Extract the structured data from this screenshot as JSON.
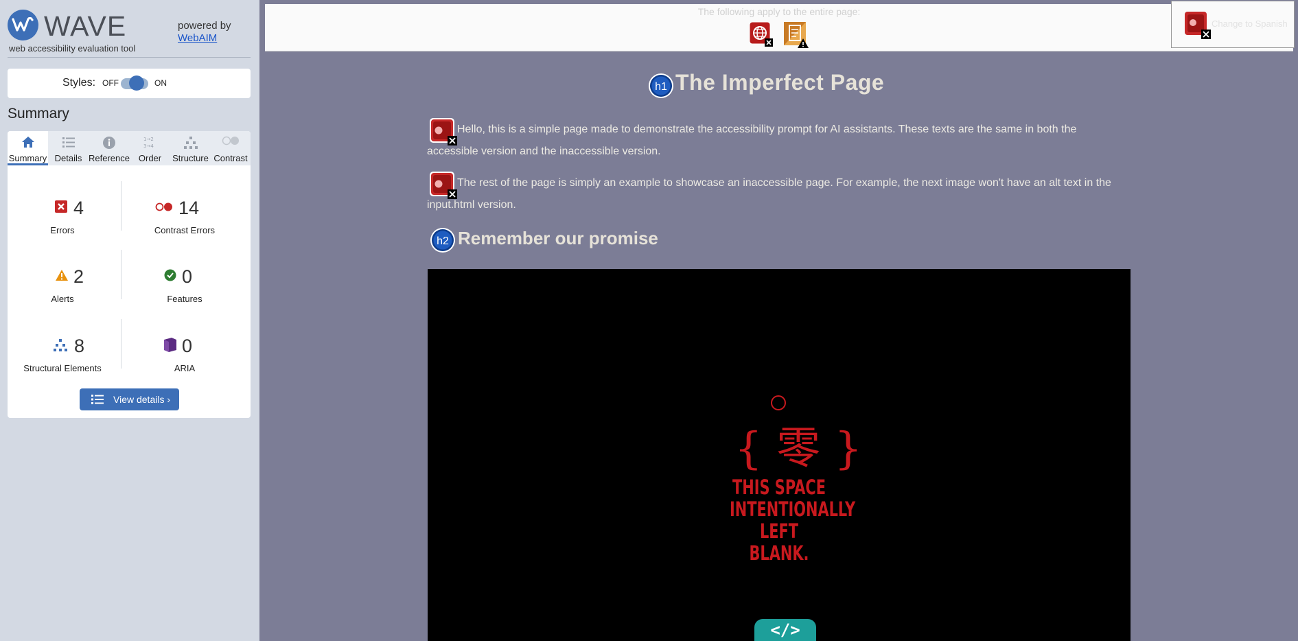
{
  "app": {
    "logo_text": "WAVE",
    "tagline": "web accessibility evaluation tool",
    "powered_by": "powered by",
    "webaim_link": "WebAIM"
  },
  "styles": {
    "label": "Styles:",
    "off": "OFF",
    "on": "ON",
    "state": "on"
  },
  "summary": {
    "heading": "Summary",
    "tabs": [
      {
        "label": "Summary",
        "icon": "home-icon",
        "active": true
      },
      {
        "label": "Details",
        "icon": "list-icon",
        "active": false
      },
      {
        "label": "Reference",
        "icon": "info-icon",
        "active": false
      },
      {
        "label": "Order",
        "icon": "order-icon",
        "active": false
      },
      {
        "label": "Structure",
        "icon": "structure-icon",
        "active": false
      },
      {
        "label": "Contrast",
        "icon": "contrast-icon",
        "active": false
      }
    ],
    "stats": {
      "errors": {
        "count": "4",
        "label": "Errors",
        "color": "#c62828"
      },
      "contrast_errors": {
        "count": "14",
        "label": "Contrast Errors",
        "color": "#c62828"
      },
      "alerts": {
        "count": "2",
        "label": "Alerts",
        "color": "#e8920f"
      },
      "features": {
        "count": "0",
        "label": "Features",
        "color": "#2e7d32"
      },
      "structural": {
        "count": "8",
        "label": "Structural Elements",
        "color": "#3d6fb7"
      },
      "aria": {
        "count": "0",
        "label": "ARIA",
        "color": "#5b2b82"
      }
    },
    "view_details": "View details ›"
  },
  "page": {
    "top_note": "The following apply to the entire page:",
    "top_icons": [
      "language-error-icon",
      "document-alert-icon"
    ],
    "change_language": "Change to Spanish",
    "h1_marker": "h1",
    "title": "The Imperfect Page",
    "paragraph1": "Hello, this is a simple page made to demonstrate the accessibility prompt for AI assistants. These texts are the same in both the accessible version and the inaccessible version.",
    "paragraph2": "The rest of the page is simply an example to showcase an inaccessible page. For example, the next image won't have an alt text in the input.html version.",
    "h2_marker": "h2",
    "section_title": "Remember our promise",
    "image": {
      "kanji": "{ 零 }",
      "text_line1": "THIS SPACE",
      "text_line2": "INTENTIONALLY",
      "text_line3": "LEFT BLANK.",
      "code_badge": "</>"
    }
  }
}
